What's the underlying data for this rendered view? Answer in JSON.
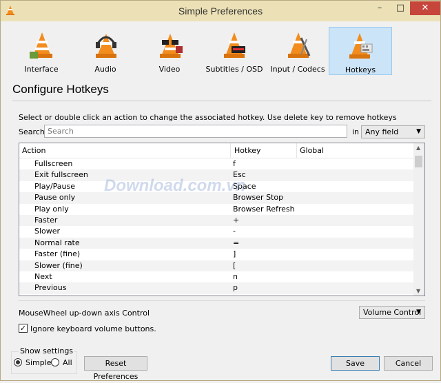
{
  "window": {
    "title": "Simple Preferences",
    "minimize": "–",
    "maximize": "□",
    "close": "✕"
  },
  "tabs": [
    {
      "label": "Interface",
      "icon": "cone-interface-icon"
    },
    {
      "label": "Audio",
      "icon": "cone-headphones-icon"
    },
    {
      "label": "Video",
      "icon": "cone-glasses-icon"
    },
    {
      "label": "Subtitles / OSD",
      "icon": "cone-subtitles-icon"
    },
    {
      "label": "Input / Codecs",
      "icon": "cone-codecs-icon"
    },
    {
      "label": "Hotkeys",
      "icon": "cone-hotkeys-icon",
      "selected": true
    }
  ],
  "page": {
    "title": "Configure Hotkeys",
    "description": "Select or double click an action to change the associated hotkey. Use delete key to remove hotkeys",
    "search_label": "Search",
    "search_placeholder": "Search",
    "in_label": "in",
    "field_select": "Any field"
  },
  "table": {
    "columns": [
      "Action",
      "Hotkey",
      "Global"
    ],
    "rows": [
      {
        "action": "Fullscreen",
        "hotkey": "f"
      },
      {
        "action": "Exit fullscreen",
        "hotkey": "Esc"
      },
      {
        "action": "Play/Pause",
        "hotkey": "Space"
      },
      {
        "action": "Pause only",
        "hotkey": "Browser Stop"
      },
      {
        "action": "Play only",
        "hotkey": "Browser Refresh"
      },
      {
        "action": "Faster",
        "hotkey": "+"
      },
      {
        "action": "Slower",
        "hotkey": "-"
      },
      {
        "action": "Normal rate",
        "hotkey": "="
      },
      {
        "action": "Faster (fine)",
        "hotkey": "]"
      },
      {
        "action": "Slower (fine)",
        "hotkey": "["
      },
      {
        "action": "Next",
        "hotkey": "n"
      },
      {
        "action": "Previous",
        "hotkey": "p"
      }
    ]
  },
  "mousewheel": {
    "label": "MouseWheel up-down axis Control",
    "value": "Volume Control"
  },
  "ignore_keyboard": {
    "label": "Ignore keyboard volume buttons.",
    "checked": true
  },
  "show_settings": {
    "title": "Show settings",
    "simple": "Simple",
    "all": "All",
    "selected": "Simple"
  },
  "buttons": {
    "reset": "Reset Preferences",
    "save": "Save",
    "cancel": "Cancel"
  },
  "watermark": "Download.com.vn",
  "colors": {
    "title_bar": "#ece1b6",
    "selected_tab": "#cce4f7",
    "close_button": "#c7463c"
  }
}
